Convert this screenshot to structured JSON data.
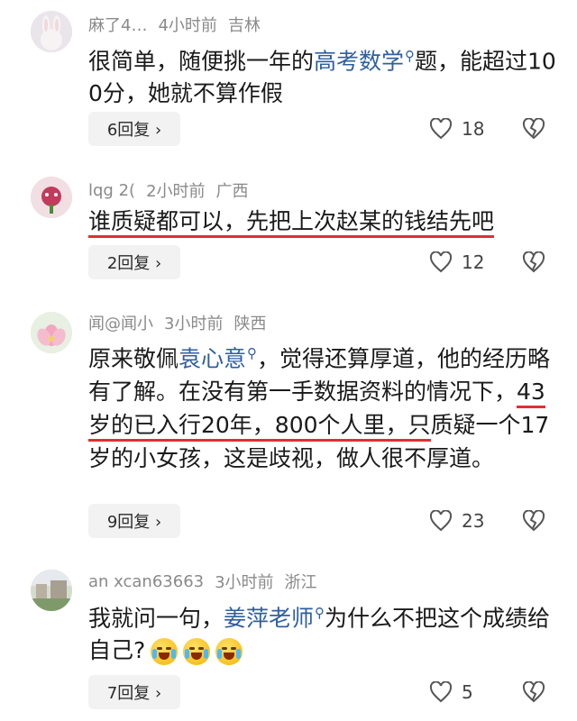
{
  "comments": [
    {
      "user": "麻了4…",
      "time": "4小时前",
      "location": "吉林",
      "text_before": "很简单，随便挑一年的",
      "link": "高考数学",
      "text_after": "题，能超过100分，她就不算作假",
      "replies": "6回复 ›",
      "likes": "18"
    },
    {
      "user": "lqg 2(",
      "time": "2小时前",
      "location": "广西",
      "text": "谁质疑都可以，先把上次赵某的钱结先吧",
      "replies": "2回复 ›",
      "likes": "12"
    },
    {
      "user": "闻@闻小",
      "time": "3小时前",
      "location": "陕西",
      "text_before": "原来敬佩",
      "link": "袁心意",
      "text_mid": "，觉得还算厚道，他的经历略有了解。在没有第一手数据资料的情况下，",
      "underlined": "43岁的已入行20年，800个人里，只",
      "text_after": "质疑一个17岁的小女孩，这是歧视，做人很不厚道。",
      "replies": "9回复 ›",
      "likes": "23"
    },
    {
      "user": "an xcan63663",
      "time": "3小时前",
      "location": "浙江",
      "text_before": "我就问一句，",
      "link": "姜萍老师",
      "text_after": "为什么不把这个成绩给自己?",
      "replies": "7回复 ›",
      "likes": "5"
    }
  ],
  "icons": {
    "search": "magnifier-icon",
    "like": "heart-icon",
    "dislike": "broken-heart-icon",
    "emoji": "crying-laughing-emoji"
  },
  "colors": {
    "link": "#2f5f9e",
    "underline": "#e03030",
    "meta": "#8a8a8a"
  }
}
